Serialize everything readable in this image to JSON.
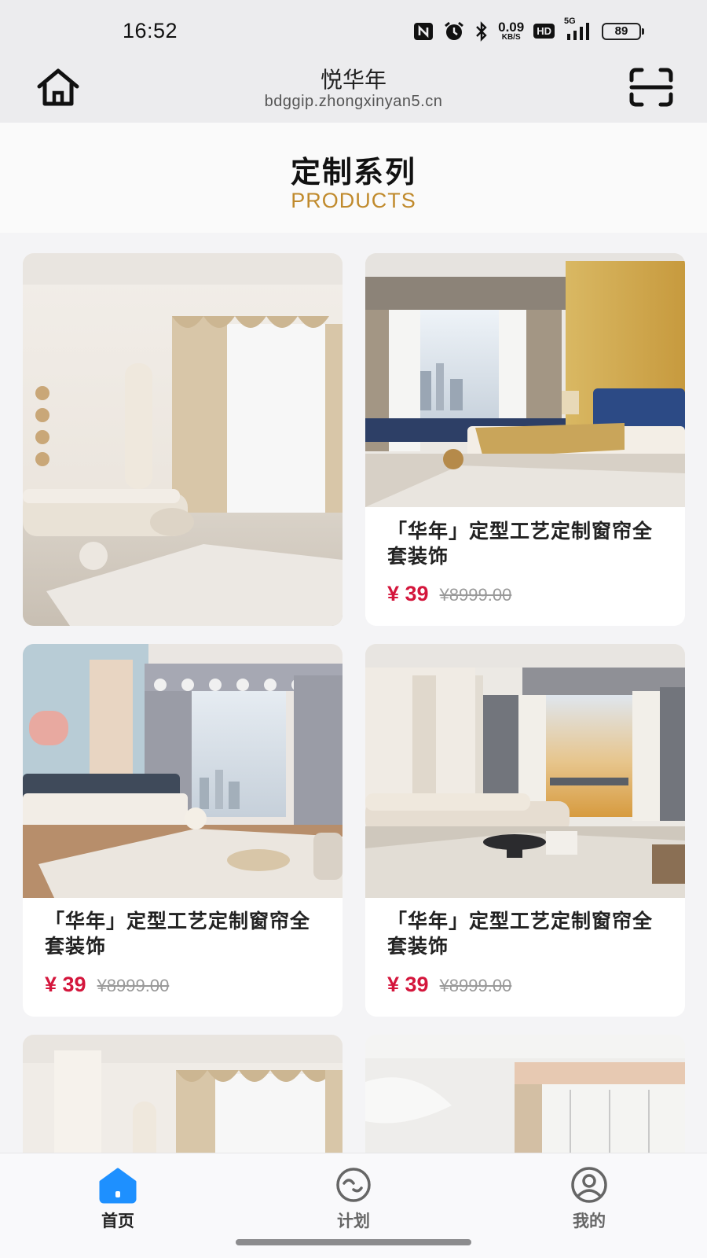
{
  "status_bar": {
    "time": "16:52",
    "net_speed_value": "0.09",
    "net_speed_unit": "KB/S",
    "hd_label": "HD",
    "network_type": "5G",
    "battery": "89",
    "icons": [
      "nfc-icon",
      "alarm-icon",
      "bluetooth-icon",
      "signal-icon"
    ]
  },
  "header": {
    "title": "悦华年",
    "url": "bdggip.zhongxinyan5.cn",
    "left_icon": "home-icon",
    "right_icon": "scan-icon"
  },
  "section": {
    "title": "定制系列",
    "subtitle": "PRODUCTS"
  },
  "products": [
    {
      "title": "",
      "price": "",
      "old_price": ""
    },
    {
      "title": "「华年」定型工艺定制窗帘全套装饰",
      "price": "¥ 39",
      "old_price": "¥8999.00"
    },
    {
      "title": "「华年」定型工艺定制窗帘全套装饰",
      "price": "¥ 39",
      "old_price": "¥8999.00"
    },
    {
      "title": "「华年」定型工艺定制窗帘全套装饰",
      "price": "¥ 39",
      "old_price": "¥8999.00"
    }
  ],
  "tabs": [
    {
      "label": "首页",
      "icon": "home-filled-icon",
      "active": true
    },
    {
      "label": "计划",
      "icon": "plan-icon",
      "active": false
    },
    {
      "label": "我的",
      "icon": "profile-icon",
      "active": false
    }
  ],
  "colors": {
    "accent": "#1e90ff",
    "price": "#d4163c",
    "subtitle": "#c08a2c"
  }
}
